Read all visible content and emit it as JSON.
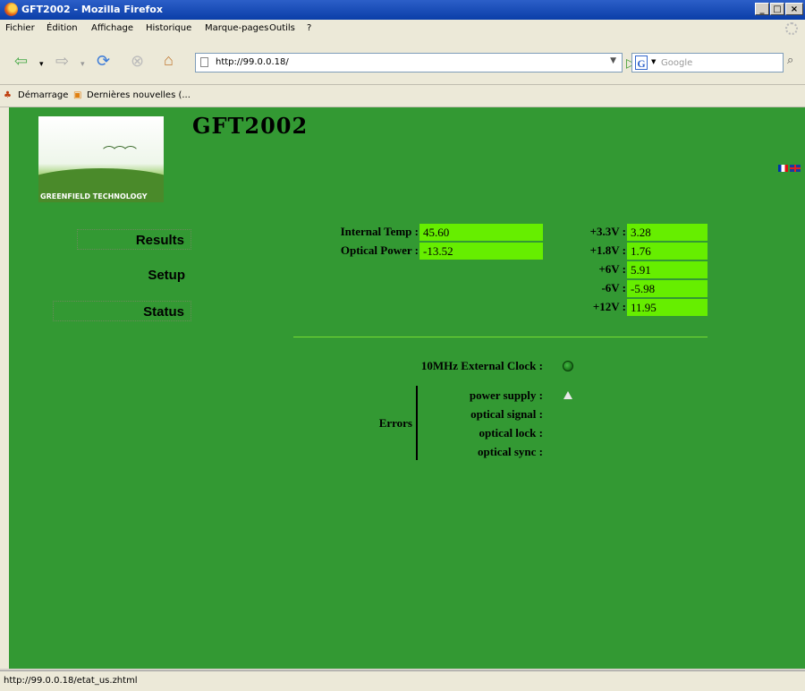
{
  "window": {
    "title": "GFT2002 - Mozilla Firefox"
  },
  "menu": [
    "Fichier",
    "Édition",
    "Affichage",
    "Historique",
    "Marque-pages",
    "Outils",
    "?"
  ],
  "toolbar": {
    "url": "http://99.0.0.18/",
    "search_placeholder": "Google"
  },
  "bookmarks": [
    "Démarrage",
    "Dernières nouvelles (..."
  ],
  "page": {
    "logo_text": "GREENFIELD TECHNOLOGY",
    "title": "GFT2002",
    "nav": {
      "results": "Results",
      "setup": "Setup",
      "status": "Status"
    },
    "measures": {
      "internal_temp_label": "Internal Temp :",
      "internal_temp_value": "45.60",
      "optical_power_label": "Optical Power :",
      "optical_power_value": "-13.52"
    },
    "voltages": [
      {
        "label": "+3.3V :",
        "value": "3.28"
      },
      {
        "label": "+1.8V :",
        "value": "1.76"
      },
      {
        "label": "+6V :",
        "value": "5.91"
      },
      {
        "label": "-6V :",
        "value": "-5.98"
      },
      {
        "label": "+12V :",
        "value": "11.95"
      }
    ],
    "clock_label": "10MHz External Clock :",
    "errors": {
      "title": "Errors",
      "items": [
        "power supply :",
        "optical signal :",
        "optical lock :",
        "optical sync :"
      ]
    }
  },
  "status_bar": "http://99.0.0.18/etat_us.zhtml",
  "colors": {
    "page_bg": "#339933",
    "value_bg": "#66ee00"
  }
}
